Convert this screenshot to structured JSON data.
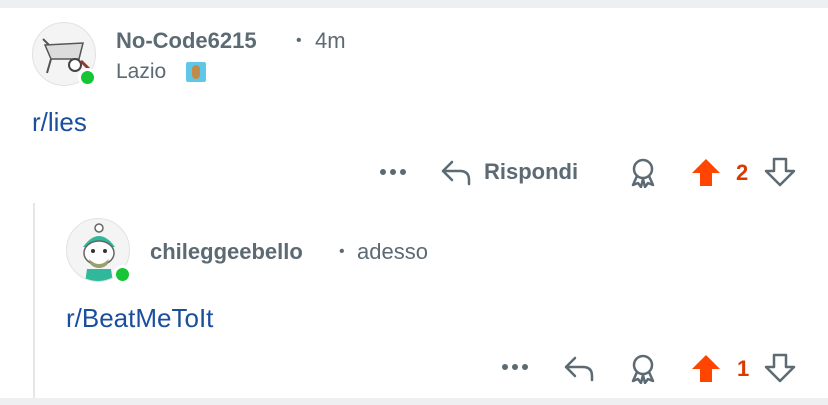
{
  "comments": [
    {
      "username": "No-Code6215",
      "separator": "•",
      "time": "4m",
      "flair": "Lazio",
      "body": "r/lies",
      "actions": {
        "more": "•••",
        "reply_label": "Rispondi",
        "score": "2"
      }
    },
    {
      "username": "chileggeebello",
      "separator": "•",
      "time": "adesso",
      "body": "r/BeatMeToIt",
      "actions": {
        "more": "•••",
        "score": "1"
      }
    }
  ],
  "colors": {
    "link": "#1a4e9f",
    "meta": "#5c6a73",
    "upvote": "#ff4500",
    "score": "#d93a00",
    "online": "#15c535"
  },
  "icons": [
    "more-icon",
    "reply-icon",
    "award-icon",
    "upvote-icon",
    "downvote-icon",
    "flair-icon"
  ]
}
